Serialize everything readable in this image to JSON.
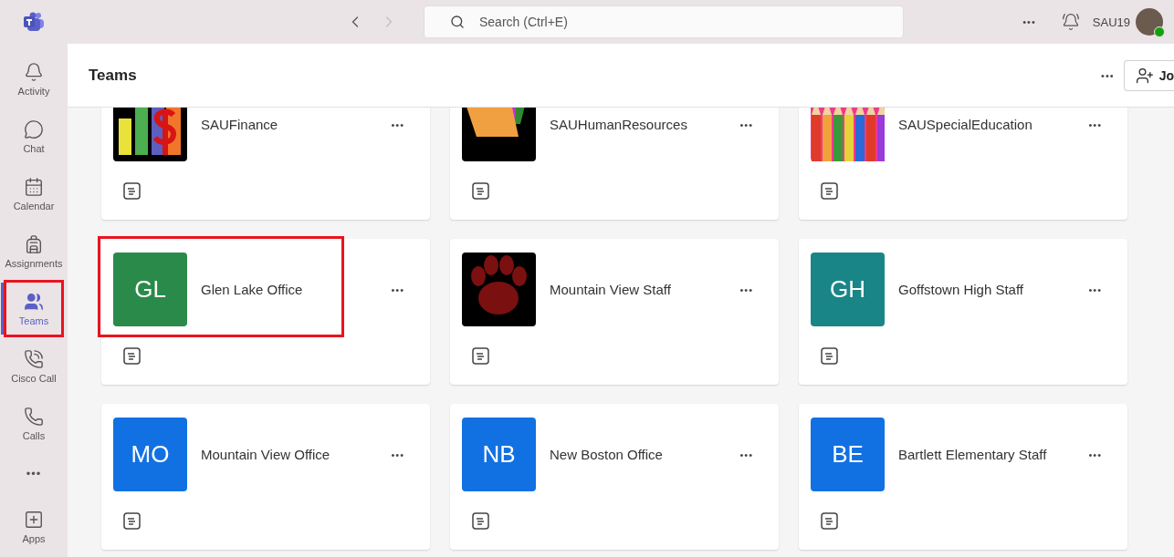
{
  "topbar": {
    "back_disabled": false,
    "forward_disabled": true,
    "search": {
      "placeholder": "Search (Ctrl+E)"
    },
    "more": "•••",
    "user": "SAU19",
    "online": true
  },
  "rail": {
    "items": [
      {
        "label": "Activity",
        "kind": "bell",
        "selected": false,
        "highlighted": false
      },
      {
        "label": "Chat",
        "kind": "chat",
        "selected": false,
        "highlighted": false
      },
      {
        "label": "Calendar",
        "kind": "calendar",
        "selected": false,
        "highlighted": false
      },
      {
        "label": "Assignments",
        "kind": "backpack",
        "selected": false,
        "highlighted": false
      },
      {
        "label": "Teams",
        "kind": "teams",
        "selected": true,
        "highlighted": true
      },
      {
        "label": "Cisco Call",
        "kind": "cisco",
        "selected": false,
        "highlighted": false
      },
      {
        "label": "Calls",
        "kind": "phone",
        "selected": false,
        "highlighted": false
      },
      {
        "label": "•••",
        "kind": "more",
        "selected": false,
        "highlighted": false
      },
      {
        "label": "Apps",
        "kind": "apps",
        "selected": false,
        "highlighted": false
      }
    ]
  },
  "header": {
    "title": "Teams",
    "more": "•••",
    "join_button": "Jo"
  },
  "teams": [
    {
      "name": "SAUFinance",
      "more": "•••",
      "avatar": {
        "kind": "chart"
      },
      "highlighted": false
    },
    {
      "name": "SAUHumanResources",
      "more": "•••",
      "avatar": {
        "kind": "folders"
      },
      "highlighted": false
    },
    {
      "name": "SAUSpecialEducation",
      "more": "•••",
      "avatar": {
        "kind": "pencils"
      },
      "highlighted": false
    },
    {
      "name": "Glen Lake Office",
      "more": "•••",
      "avatar": {
        "kind": "initials",
        "text": "GL",
        "color": "#2a8a4a"
      },
      "highlighted": true
    },
    {
      "name": "Mountain View Staff",
      "more": "•••",
      "avatar": {
        "kind": "paw"
      },
      "highlighted": false
    },
    {
      "name": "Goffstown High Staff",
      "more": "•••",
      "avatar": {
        "kind": "initials",
        "text": "GH",
        "color": "#1a8586"
      },
      "highlighted": false
    },
    {
      "name": "Mountain View Office",
      "more": "•••",
      "avatar": {
        "kind": "initials",
        "text": "MO",
        "color": "#1271e2"
      },
      "highlighted": false
    },
    {
      "name": "New Boston Office",
      "more": "•••",
      "avatar": {
        "kind": "initials",
        "text": "NB",
        "color": "#1271e2"
      },
      "highlighted": false
    },
    {
      "name": "Bartlett Elementary Staff",
      "more": "•••",
      "avatar": {
        "kind": "initials",
        "text": "BE",
        "color": "#1271e2"
      },
      "highlighted": false
    }
  ]
}
